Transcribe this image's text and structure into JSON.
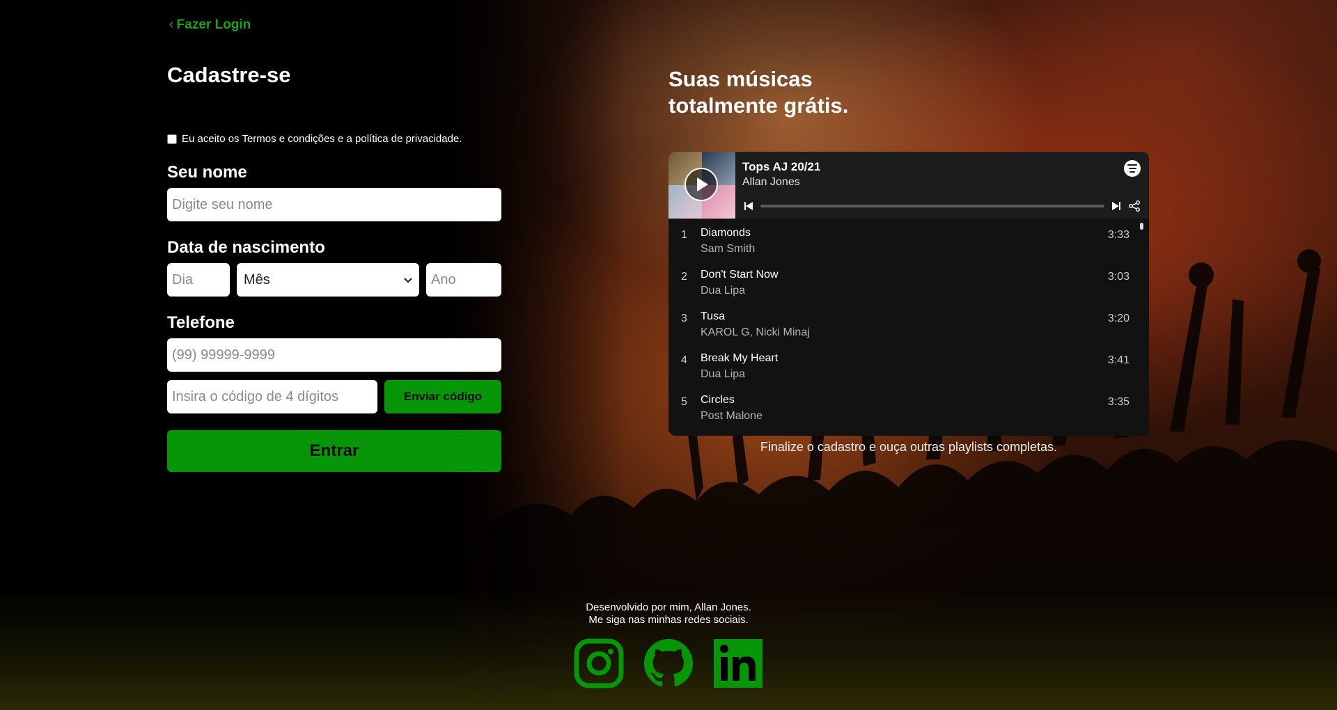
{
  "nav": {
    "back_label": "Fazer Login"
  },
  "form": {
    "title": "Cadastre-se",
    "terms_label": "Eu aceito os Termos e condições e a política de privacidade.",
    "terms_checked": false,
    "name_label": "Seu nome",
    "name_placeholder": "Digite seu nome",
    "dob_label": "Data de nascimento",
    "day_placeholder": "Dia",
    "month_selected": "Mês",
    "year_placeholder": "Ano",
    "phone_label": "Telefone",
    "phone_placeholder": "(99) 99999-9999",
    "code_placeholder": "Insira o código de 4 dígitos",
    "send_code_label": "Enviar código",
    "submit_label": "Entrar"
  },
  "promo": {
    "title_line1": "Suas músicas",
    "title_line2": "totalmente grátis.",
    "caption": "Finalize o cadastro e ouça outras playlists completas."
  },
  "player": {
    "playlist_title": "Tops AJ 20/21",
    "playlist_artist": "Allan Jones",
    "progress": 0,
    "tracks": [
      {
        "num": "1",
        "title": "Diamonds",
        "artist": "Sam Smith",
        "duration": "3:33"
      },
      {
        "num": "2",
        "title": "Don't Start Now",
        "artist": "Dua Lipa",
        "duration": "3:03"
      },
      {
        "num": "3",
        "title": "Tusa",
        "artist": "KAROL G, Nicki Minaj",
        "duration": "3:20"
      },
      {
        "num": "4",
        "title": "Break My Heart",
        "artist": "Dua Lipa",
        "duration": "3:41"
      },
      {
        "num": "5",
        "title": "Circles",
        "artist": "Post Malone",
        "duration": "3:35"
      }
    ]
  },
  "footer": {
    "line1": "Desenvolvido por mim, Allan Jones.",
    "line2": "Me siga nas minhas redes sociais."
  },
  "colors": {
    "accent": "#079607",
    "link": "#16a317",
    "player_bg": "#121212"
  },
  "icons": {
    "back": "chevron-left-icon",
    "play": "play-icon",
    "spotify": "spotify-icon",
    "prev": "skip-back-icon",
    "next": "skip-forward-icon",
    "share": "share-icon",
    "instagram": "instagram-icon",
    "github": "github-icon",
    "linkedin": "linkedin-icon"
  }
}
